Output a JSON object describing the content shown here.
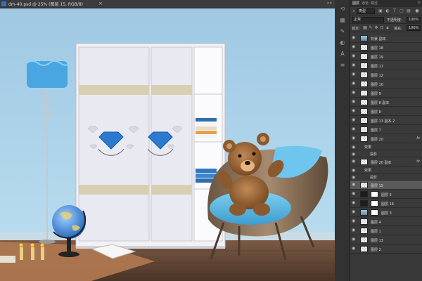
{
  "document": {
    "title": "dm-40.psd @ 25% (图层 15, RGB/8)",
    "close_glyph": "×",
    "collapse_glyph": "««"
  },
  "panel_tabs": [
    {
      "label": "图层",
      "active": true
    },
    {
      "label": "通道",
      "active": false
    },
    {
      "label": "路径",
      "active": false
    }
  ],
  "filter": {
    "kind": "类型"
  },
  "blend": {
    "mode": "正常",
    "opacity_label": "不透明度:",
    "opacity": "100%"
  },
  "lock": {
    "label": "锁定:",
    "fill_label": "填充:",
    "fill": "100%"
  },
  "layers": [
    {
      "name": "背景 副本",
      "thumb": "img",
      "fx": false,
      "selected": false,
      "mask": false
    },
    {
      "name": "图层 18",
      "thumb": "checker",
      "fx": false,
      "selected": false,
      "mask": false
    },
    {
      "name": "图层 19",
      "thumb": "checker",
      "fx": false,
      "selected": false,
      "mask": false
    },
    {
      "name": "图层 17",
      "thumb": "checker",
      "fx": false,
      "selected": false,
      "mask": false
    },
    {
      "name": "图层 12",
      "thumb": "checker",
      "fx": false,
      "selected": false,
      "mask": false
    },
    {
      "name": "图层 10",
      "thumb": "checker",
      "fx": false,
      "selected": false,
      "mask": false
    },
    {
      "name": "图层 9",
      "thumb": "checker",
      "fx": false,
      "selected": false,
      "mask": false
    },
    {
      "name": "图层 8 副本",
      "thumb": "checker",
      "fx": false,
      "selected": false,
      "mask": false
    },
    {
      "name": "图层 8",
      "thumb": "checker",
      "fx": false,
      "selected": false,
      "mask": false
    },
    {
      "name": "图层 13 副本 2",
      "thumb": "checker",
      "fx": false,
      "selected": false,
      "mask": false
    },
    {
      "name": "图层 7",
      "thumb": "checker",
      "fx": false,
      "selected": false,
      "mask": false
    },
    {
      "name": "图层 20",
      "thumb": "checker",
      "fx": true,
      "selected": false,
      "mask": false
    },
    {
      "name": "效果",
      "sub": true
    },
    {
      "name": "投影",
      "sub": true
    },
    {
      "name": "图层 20 副本",
      "thumb": "checker",
      "fx": true,
      "selected": false,
      "mask": false
    },
    {
      "name": "效果",
      "sub": true
    },
    {
      "name": "投影",
      "sub": true
    },
    {
      "name": "图层 15",
      "thumb": "checker",
      "fx": false,
      "selected": true,
      "mask": false
    },
    {
      "name": "图层 5",
      "thumb": "dark",
      "fx": false,
      "selected": false,
      "mask": true
    },
    {
      "name": "图层 16",
      "thumb": "dark",
      "fx": false,
      "selected": false,
      "mask": true
    },
    {
      "name": "图层 3",
      "thumb": "img",
      "fx": false,
      "selected": false,
      "mask": true
    },
    {
      "name": "图层 4",
      "thumb": "checker",
      "fx": false,
      "selected": false,
      "mask": false
    },
    {
      "name": "图层 1",
      "thumb": "checker",
      "fx": false,
      "selected": false,
      "mask": false
    },
    {
      "name": "图层 13",
      "thumb": "checker",
      "fx": false,
      "selected": false,
      "mask": false
    },
    {
      "name": "图层 2",
      "thumb": "checker",
      "fx": false,
      "selected": false,
      "mask": false
    }
  ],
  "icons": {
    "eye": "eye-icon",
    "fx": "fx",
    "strip": [
      "history-icon",
      "swatch-icon",
      "brush-icon",
      "adjust-icon",
      "text-icon",
      "layers-icon"
    ]
  },
  "colors": {
    "wall": "#a7cde6",
    "floor": "#5a4030",
    "accent_blue": "#3b8fd6",
    "selection": "#5a5a5a"
  }
}
